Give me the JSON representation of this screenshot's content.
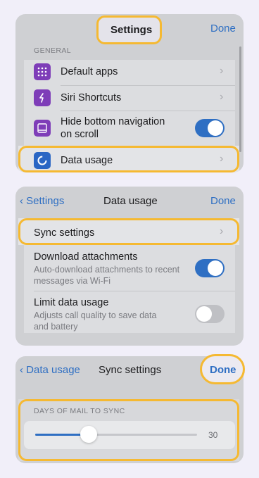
{
  "panel1": {
    "title": "Settings",
    "done": "Done",
    "section": "GENERAL",
    "items": [
      {
        "label": "Default apps",
        "icon": "grid-icon"
      },
      {
        "label": "Siri Shortcuts",
        "icon": "siri-shortcuts-icon"
      },
      {
        "label": "Hide bottom navigation",
        "label2": "on scroll",
        "icon": "bottom-nav-icon",
        "toggle": true
      },
      {
        "label": "Data usage",
        "icon": "data-usage-icon"
      }
    ]
  },
  "panel2": {
    "back": "Settings",
    "title": "Data usage",
    "done": "Done",
    "sync": {
      "label": "Sync settings"
    },
    "download": {
      "label": "Download attachments",
      "sub1": "Auto-download attachments to recent",
      "sub2": "messages via Wi-Fi",
      "toggle": true
    },
    "limit": {
      "label": "Limit data usage",
      "sub1": "Adjusts call quality to save data",
      "sub2": "and battery",
      "toggle": false
    }
  },
  "panel3": {
    "back": "Data usage",
    "title": "Sync settings",
    "done": "Done",
    "section": "DAYS OF MAIL TO SYNC",
    "slider_value": "30",
    "slider_fraction": 0.33
  },
  "colors": {
    "accent": "#2f6fc3",
    "highlight": "#f5b932",
    "icon_purple": "#7e3db8",
    "toggle_on": "#2f6fc3",
    "toggle_off": "#bfc0c4"
  }
}
